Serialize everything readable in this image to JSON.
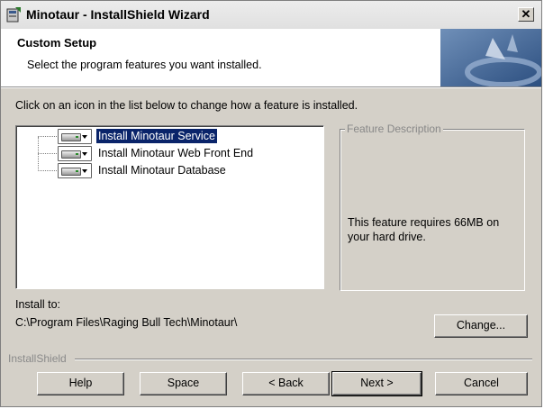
{
  "window": {
    "title": "Minotaur - InstallShield Wizard",
    "close_glyph": "✕"
  },
  "banner": {
    "title": "Custom Setup",
    "subtitle": "Select the program features you want installed."
  },
  "instruction": "Click on an icon in the list below to change how a feature is installed.",
  "features": [
    {
      "label": "Install Minotaur Service",
      "selected": true,
      "icon": "hard-drive-icon"
    },
    {
      "label": "Install Minotaur Web Front End",
      "selected": false,
      "icon": "hard-drive-icon"
    },
    {
      "label": "Install Minotaur Database",
      "selected": false,
      "icon": "hard-drive-icon"
    }
  ],
  "description": {
    "legend": "Feature Description",
    "text": "This feature requires 66MB on your hard drive."
  },
  "install_to": {
    "label": "Install to:",
    "path": "C:\\Program Files\\Raging Bull Tech\\Minotaur\\"
  },
  "buttons": {
    "change": "Change...",
    "help": "Help",
    "space": "Space",
    "back": "< Back",
    "next": "Next >",
    "cancel": "Cancel"
  },
  "brand": "InstallShield",
  "colors": {
    "selection": "#0a246a",
    "dialog_bg": "#d4d0c8",
    "banner_accent": "#3a5a8c"
  }
}
